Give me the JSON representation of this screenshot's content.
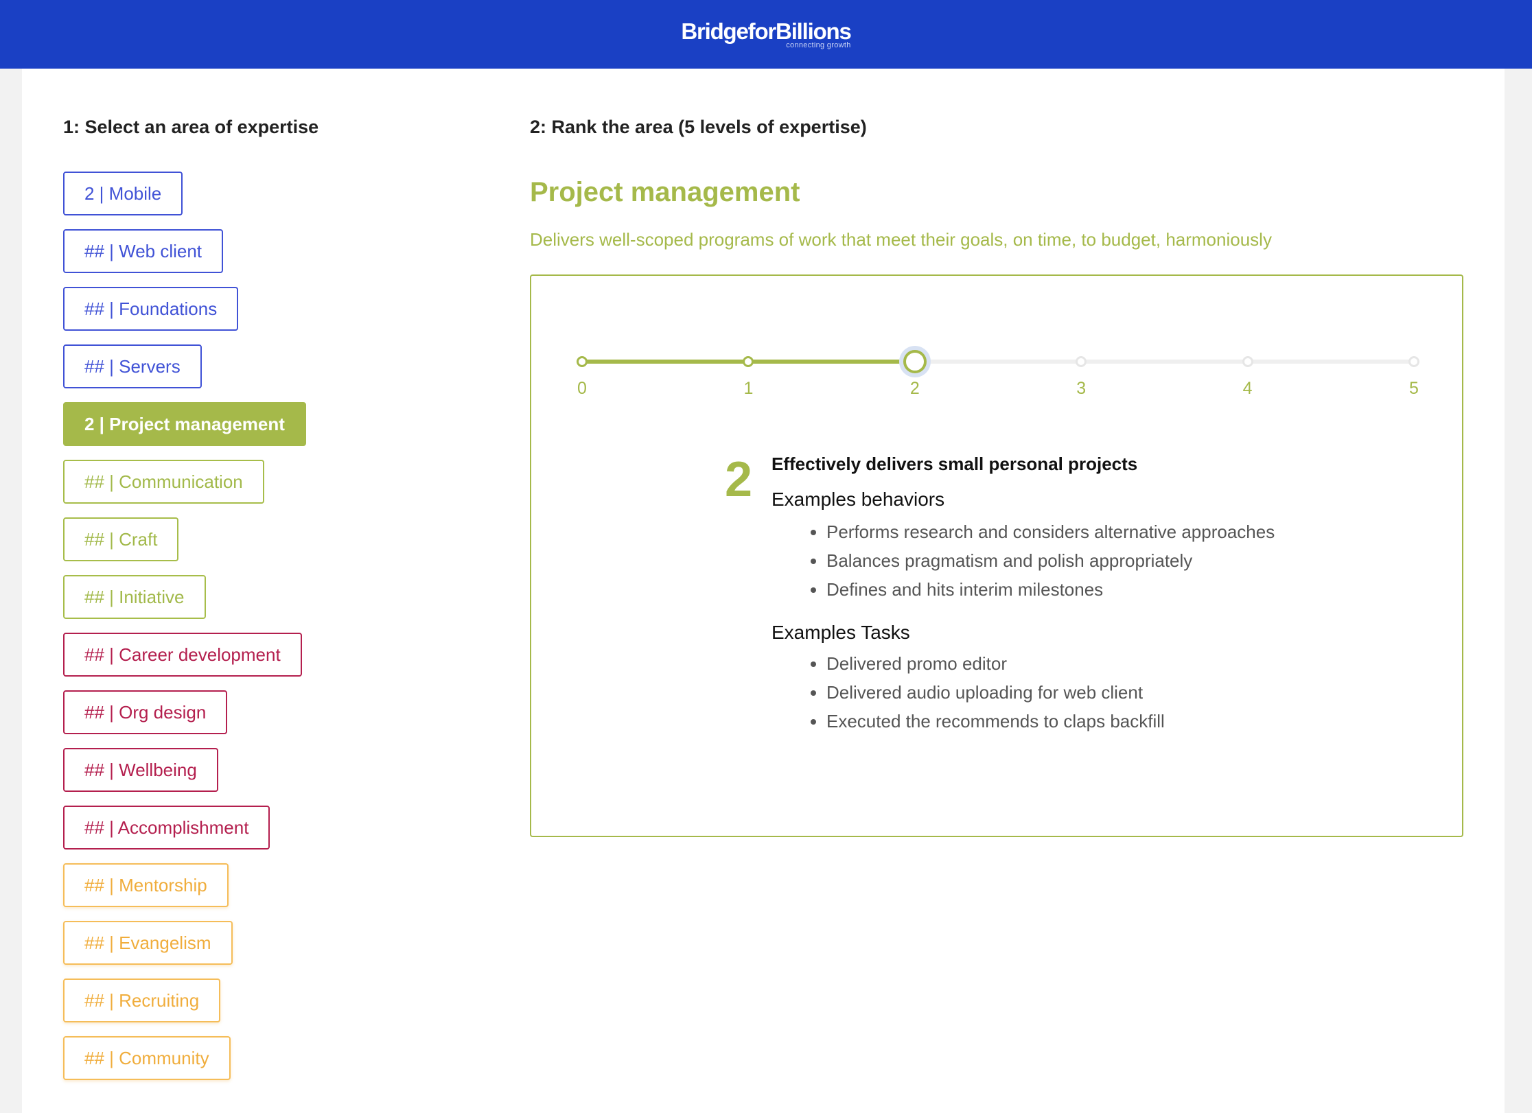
{
  "header": {
    "logo_name": "BridgeforBillions",
    "logo_tagline": "connecting growth",
    "brand_color": "#1a40c4"
  },
  "step1": {
    "title": "1: Select an area of expertise",
    "areas": [
      {
        "label": "2 | Mobile",
        "color": "blue",
        "selected": false
      },
      {
        "label": "## | Web client",
        "color": "blue",
        "selected": false
      },
      {
        "label": "## | Foundations",
        "color": "blue",
        "selected": false
      },
      {
        "label": "## | Servers",
        "color": "blue",
        "selected": false
      },
      {
        "label": "2 | Project management",
        "color": "green",
        "selected": true
      },
      {
        "label": "## | Communication",
        "color": "green",
        "selected": false
      },
      {
        "label": "## | Craft",
        "color": "green",
        "selected": false
      },
      {
        "label": "## | Initiative",
        "color": "green",
        "selected": false
      },
      {
        "label": "## | Career development",
        "color": "red",
        "selected": false
      },
      {
        "label": "## | Org design",
        "color": "red",
        "selected": false
      },
      {
        "label": "## | Wellbeing",
        "color": "red",
        "selected": false
      },
      {
        "label": "## | Accomplishment",
        "color": "red",
        "selected": false
      },
      {
        "label": "## | Mentorship",
        "color": "orange",
        "selected": false
      },
      {
        "label": "## | Evangelism",
        "color": "orange",
        "selected": false
      },
      {
        "label": "## | Recruiting",
        "color": "orange",
        "selected": false
      },
      {
        "label": "## | Community",
        "color": "orange",
        "selected": false
      }
    ],
    "colors": {
      "blue": "#4052d6",
      "green": "#a5b94a",
      "red": "#b41f4e",
      "orange": "#f0ad3c"
    }
  },
  "step2": {
    "title": "2: Rank the area (5 levels of expertise)",
    "area_title": "Project management",
    "area_description": "Delivers well-scoped programs of work that meet their goals, on time, to budget, harmoniously",
    "slider": {
      "min": 0,
      "max": 5,
      "value": 2,
      "ticks": [
        "0",
        "1",
        "2",
        "3",
        "4",
        "5"
      ]
    },
    "level": {
      "number": "2",
      "summary": "Effectively delivers small personal projects",
      "behaviors_heading": "Examples behaviors",
      "behaviors": [
        "Performs research and considers alternative approaches",
        "Balances pragmatism and polish appropriately",
        "Defines and hits interim milestones"
      ],
      "tasks_heading": "Examples Tasks",
      "tasks": [
        "Delivered promo editor",
        "Delivered audio uploading for web client",
        "Executed the recommends to claps backfill"
      ]
    }
  }
}
